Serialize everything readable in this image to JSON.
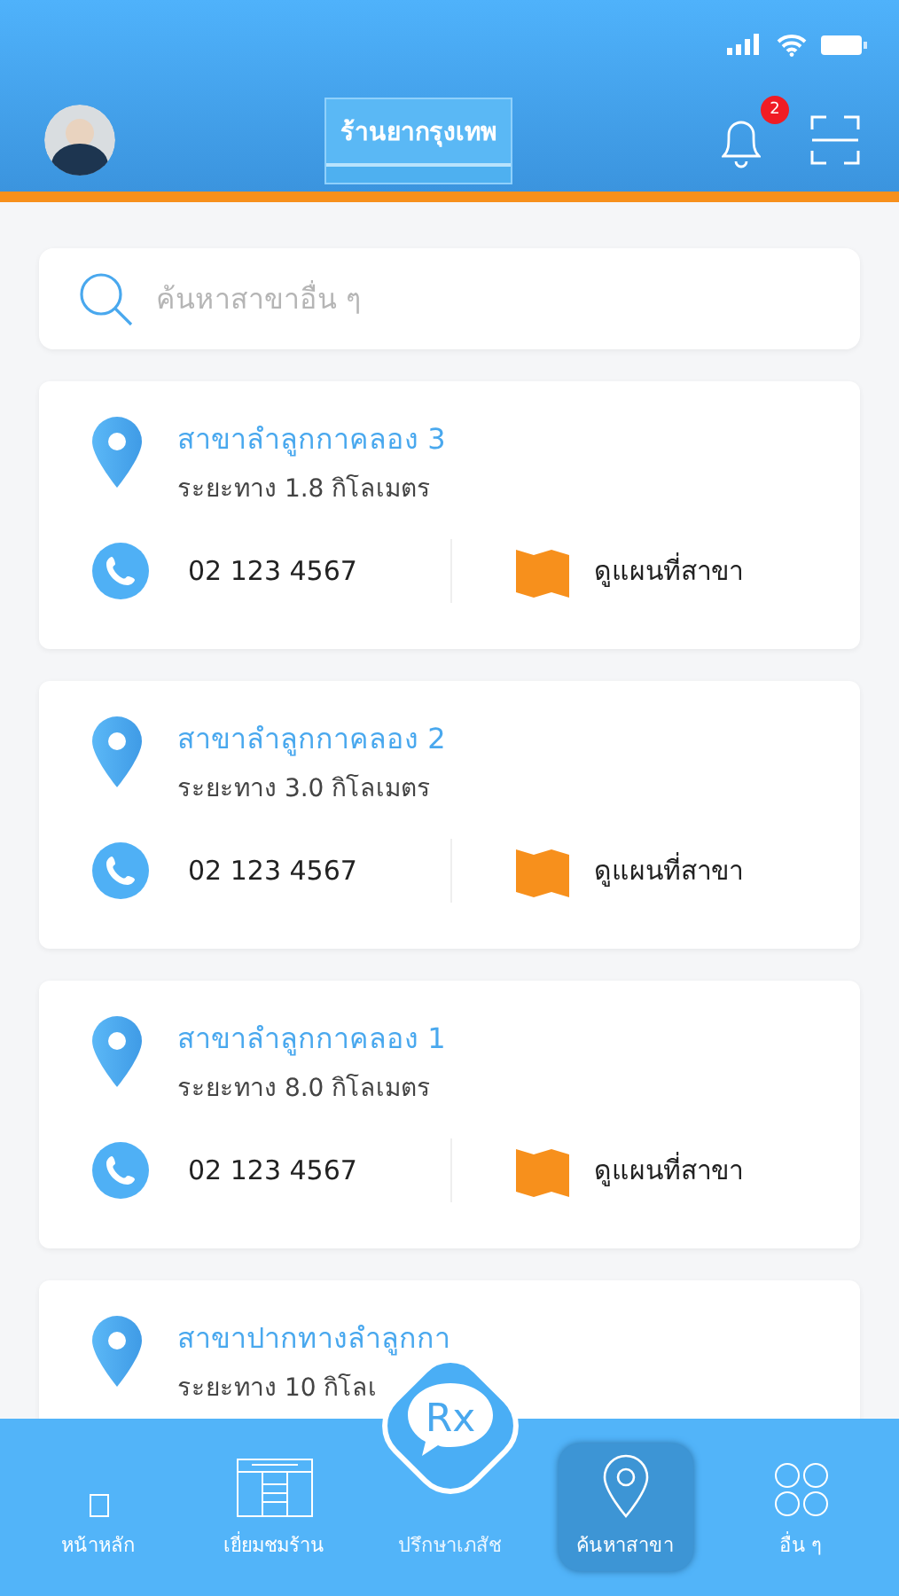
{
  "header": {
    "title": "ร้านยากรุงเทพ",
    "notification_count": "2"
  },
  "search": {
    "placeholder": "ค้นหาสาขาอื่น ๆ"
  },
  "branches": [
    {
      "name": "สาขาลำลูกกาคลอง 3",
      "distance": "ระยะทาง 1.8 กิโลเมตร",
      "phone": "02 123 4567",
      "map_label": "ดูแผนที่สาขา"
    },
    {
      "name": "สาขาลำลูกกาคลอง 2",
      "distance": "ระยะทาง 3.0 กิโลเมตร",
      "phone": "02 123 4567",
      "map_label": "ดูแผนที่สาขา"
    },
    {
      "name": "สาขาลำลูกกาคลอง 1",
      "distance": "ระยะทาง 8.0 กิโลเมตร",
      "phone": "02 123 4567",
      "map_label": "ดูแผนที่สาขา"
    },
    {
      "name": "สาขาปากทางลำลูกกา",
      "distance": "ระยะทาง 10 กิโลเ"
    }
  ],
  "nav": [
    {
      "kind": "home",
      "label": "หน้าหลัก",
      "selected": false
    },
    {
      "kind": "store",
      "label": "เยี่ยมชมร้าน",
      "selected": false
    },
    {
      "kind": "consult",
      "label": "ปรึกษาเภสัช",
      "symbol": "Rx",
      "selected": false
    },
    {
      "kind": "branch",
      "label": "ค้นหาสาขา",
      "selected": true
    },
    {
      "kind": "more",
      "label": "อื่น ๆ",
      "selected": false
    }
  ]
}
